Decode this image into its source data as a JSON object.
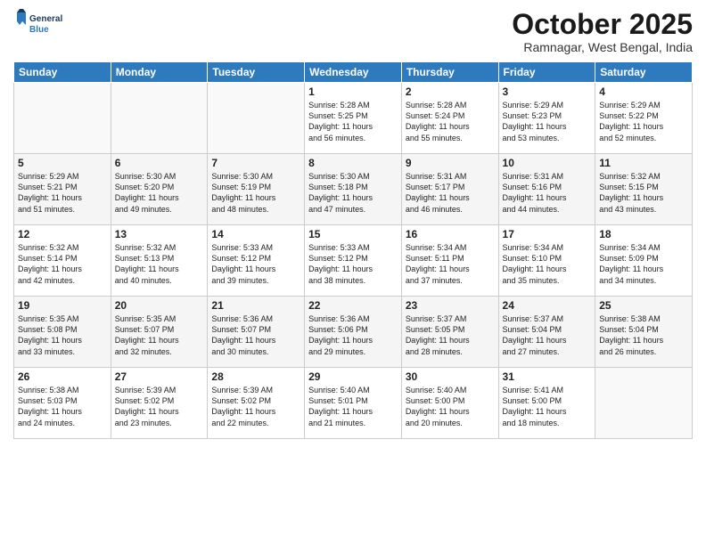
{
  "logo": {
    "line1": "General",
    "line2": "Blue"
  },
  "title": "October 2025",
  "location": "Ramnagar, West Bengal, India",
  "weekdays": [
    "Sunday",
    "Monday",
    "Tuesday",
    "Wednesday",
    "Thursday",
    "Friday",
    "Saturday"
  ],
  "weeks": [
    [
      {
        "day": "",
        "info": ""
      },
      {
        "day": "",
        "info": ""
      },
      {
        "day": "",
        "info": ""
      },
      {
        "day": "1",
        "info": "Sunrise: 5:28 AM\nSunset: 5:25 PM\nDaylight: 11 hours\nand 56 minutes."
      },
      {
        "day": "2",
        "info": "Sunrise: 5:28 AM\nSunset: 5:24 PM\nDaylight: 11 hours\nand 55 minutes."
      },
      {
        "day": "3",
        "info": "Sunrise: 5:29 AM\nSunset: 5:23 PM\nDaylight: 11 hours\nand 53 minutes."
      },
      {
        "day": "4",
        "info": "Sunrise: 5:29 AM\nSunset: 5:22 PM\nDaylight: 11 hours\nand 52 minutes."
      }
    ],
    [
      {
        "day": "5",
        "info": "Sunrise: 5:29 AM\nSunset: 5:21 PM\nDaylight: 11 hours\nand 51 minutes."
      },
      {
        "day": "6",
        "info": "Sunrise: 5:30 AM\nSunset: 5:20 PM\nDaylight: 11 hours\nand 49 minutes."
      },
      {
        "day": "7",
        "info": "Sunrise: 5:30 AM\nSunset: 5:19 PM\nDaylight: 11 hours\nand 48 minutes."
      },
      {
        "day": "8",
        "info": "Sunrise: 5:30 AM\nSunset: 5:18 PM\nDaylight: 11 hours\nand 47 minutes."
      },
      {
        "day": "9",
        "info": "Sunrise: 5:31 AM\nSunset: 5:17 PM\nDaylight: 11 hours\nand 46 minutes."
      },
      {
        "day": "10",
        "info": "Sunrise: 5:31 AM\nSunset: 5:16 PM\nDaylight: 11 hours\nand 44 minutes."
      },
      {
        "day": "11",
        "info": "Sunrise: 5:32 AM\nSunset: 5:15 PM\nDaylight: 11 hours\nand 43 minutes."
      }
    ],
    [
      {
        "day": "12",
        "info": "Sunrise: 5:32 AM\nSunset: 5:14 PM\nDaylight: 11 hours\nand 42 minutes."
      },
      {
        "day": "13",
        "info": "Sunrise: 5:32 AM\nSunset: 5:13 PM\nDaylight: 11 hours\nand 40 minutes."
      },
      {
        "day": "14",
        "info": "Sunrise: 5:33 AM\nSunset: 5:12 PM\nDaylight: 11 hours\nand 39 minutes."
      },
      {
        "day": "15",
        "info": "Sunrise: 5:33 AM\nSunset: 5:12 PM\nDaylight: 11 hours\nand 38 minutes."
      },
      {
        "day": "16",
        "info": "Sunrise: 5:34 AM\nSunset: 5:11 PM\nDaylight: 11 hours\nand 37 minutes."
      },
      {
        "day": "17",
        "info": "Sunrise: 5:34 AM\nSunset: 5:10 PM\nDaylight: 11 hours\nand 35 minutes."
      },
      {
        "day": "18",
        "info": "Sunrise: 5:34 AM\nSunset: 5:09 PM\nDaylight: 11 hours\nand 34 minutes."
      }
    ],
    [
      {
        "day": "19",
        "info": "Sunrise: 5:35 AM\nSunset: 5:08 PM\nDaylight: 11 hours\nand 33 minutes."
      },
      {
        "day": "20",
        "info": "Sunrise: 5:35 AM\nSunset: 5:07 PM\nDaylight: 11 hours\nand 32 minutes."
      },
      {
        "day": "21",
        "info": "Sunrise: 5:36 AM\nSunset: 5:07 PM\nDaylight: 11 hours\nand 30 minutes."
      },
      {
        "day": "22",
        "info": "Sunrise: 5:36 AM\nSunset: 5:06 PM\nDaylight: 11 hours\nand 29 minutes."
      },
      {
        "day": "23",
        "info": "Sunrise: 5:37 AM\nSunset: 5:05 PM\nDaylight: 11 hours\nand 28 minutes."
      },
      {
        "day": "24",
        "info": "Sunrise: 5:37 AM\nSunset: 5:04 PM\nDaylight: 11 hours\nand 27 minutes."
      },
      {
        "day": "25",
        "info": "Sunrise: 5:38 AM\nSunset: 5:04 PM\nDaylight: 11 hours\nand 26 minutes."
      }
    ],
    [
      {
        "day": "26",
        "info": "Sunrise: 5:38 AM\nSunset: 5:03 PM\nDaylight: 11 hours\nand 24 minutes."
      },
      {
        "day": "27",
        "info": "Sunrise: 5:39 AM\nSunset: 5:02 PM\nDaylight: 11 hours\nand 23 minutes."
      },
      {
        "day": "28",
        "info": "Sunrise: 5:39 AM\nSunset: 5:02 PM\nDaylight: 11 hours\nand 22 minutes."
      },
      {
        "day": "29",
        "info": "Sunrise: 5:40 AM\nSunset: 5:01 PM\nDaylight: 11 hours\nand 21 minutes."
      },
      {
        "day": "30",
        "info": "Sunrise: 5:40 AM\nSunset: 5:00 PM\nDaylight: 11 hours\nand 20 minutes."
      },
      {
        "day": "31",
        "info": "Sunrise: 5:41 AM\nSunset: 5:00 PM\nDaylight: 11 hours\nand 18 minutes."
      },
      {
        "day": "",
        "info": ""
      }
    ]
  ]
}
